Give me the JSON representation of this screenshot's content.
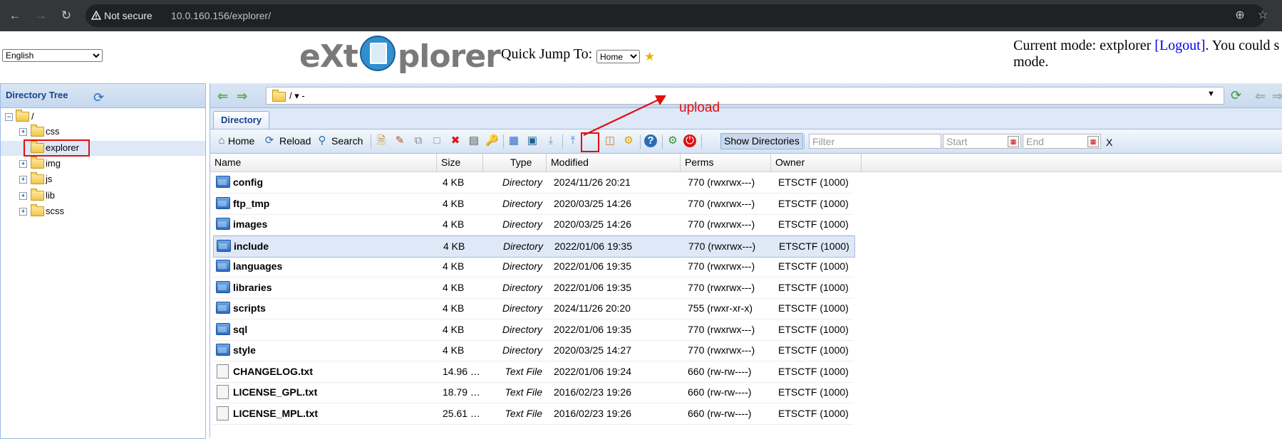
{
  "browser": {
    "security_label": "Not secure",
    "url": "10.0.160.156/explorer/"
  },
  "header": {
    "language": "English",
    "logo_left": "eXt",
    "logo_right": "plorer",
    "quick_jump_label": "Quick Jump To:",
    "quick_jump_value": "Home",
    "mode_prefix": "Current mode: extplorer ",
    "logout_link": "[Logout]",
    "mode_suffix": ". You could s",
    "mode_line2": "mode."
  },
  "tree": {
    "title": "Directory Tree",
    "root": "/",
    "items": [
      "css",
      "explorer",
      "img",
      "js",
      "lib",
      "scss"
    ]
  },
  "path": {
    "value": "/ ▾ -"
  },
  "tab": {
    "label": "Directory"
  },
  "toolbar": {
    "home": "Home",
    "reload": "Reload",
    "search": "Search",
    "show_dirs": "Show Directories",
    "filter_placeholder": "Filter",
    "start_placeholder": "Start",
    "end_placeholder": "End",
    "clear": "X"
  },
  "grid": {
    "columns": [
      "Name",
      "Size",
      "Type",
      "Modified",
      "Perms",
      "Owner"
    ],
    "rows": [
      {
        "name": "config",
        "size": "4 KB",
        "type": "Directory",
        "modified": "2024/11/26 20:21",
        "perms": "770 (rwxrwx---)",
        "owner": "ETSCTF (1000)",
        "kind": "dir"
      },
      {
        "name": "ftp_tmp",
        "size": "4 KB",
        "type": "Directory",
        "modified": "2020/03/25 14:26",
        "perms": "770 (rwxrwx---)",
        "owner": "ETSCTF (1000)",
        "kind": "dir"
      },
      {
        "name": "images",
        "size": "4 KB",
        "type": "Directory",
        "modified": "2020/03/25 14:26",
        "perms": "770 (rwxrwx---)",
        "owner": "ETSCTF (1000)",
        "kind": "dir"
      },
      {
        "name": "include",
        "size": "4 KB",
        "type": "Directory",
        "modified": "2022/01/06 19:35",
        "perms": "770 (rwxrwx---)",
        "owner": "ETSCTF (1000)",
        "kind": "dir"
      },
      {
        "name": "languages",
        "size": "4 KB",
        "type": "Directory",
        "modified": "2022/01/06 19:35",
        "perms": "770 (rwxrwx---)",
        "owner": "ETSCTF (1000)",
        "kind": "dir"
      },
      {
        "name": "libraries",
        "size": "4 KB",
        "type": "Directory",
        "modified": "2022/01/06 19:35",
        "perms": "770 (rwxrwx---)",
        "owner": "ETSCTF (1000)",
        "kind": "dir"
      },
      {
        "name": "scripts",
        "size": "4 KB",
        "type": "Directory",
        "modified": "2024/11/26 20:20",
        "perms": "755 (rwxr-xr-x)",
        "owner": "ETSCTF (1000)",
        "kind": "dir"
      },
      {
        "name": "sql",
        "size": "4 KB",
        "type": "Directory",
        "modified": "2022/01/06 19:35",
        "perms": "770 (rwxrwx---)",
        "owner": "ETSCTF (1000)",
        "kind": "dir"
      },
      {
        "name": "style",
        "size": "4 KB",
        "type": "Directory",
        "modified": "2020/03/25 14:27",
        "perms": "770 (rwxrwx---)",
        "owner": "ETSCTF (1000)",
        "kind": "dir"
      },
      {
        "name": "CHANGELOG.txt",
        "size": "14.96 …",
        "type": "Text File",
        "modified": "2022/01/06 19:24",
        "perms": "660 (rw-rw----)",
        "owner": "ETSCTF (1000)",
        "kind": "file"
      },
      {
        "name": "LICENSE_GPL.txt",
        "size": "18.79 …",
        "type": "Text File",
        "modified": "2016/02/23 19:26",
        "perms": "660 (rw-rw----)",
        "owner": "ETSCTF (1000)",
        "kind": "file"
      },
      {
        "name": "LICENSE_MPL.txt",
        "size": "25.61 …",
        "type": "Text File",
        "modified": "2016/02/23 19:26",
        "perms": "660 (rw-rw----)",
        "owner": "ETSCTF (1000)",
        "kind": "file"
      }
    ]
  },
  "annotation": {
    "label": "upload",
    "color": "#e01010"
  }
}
